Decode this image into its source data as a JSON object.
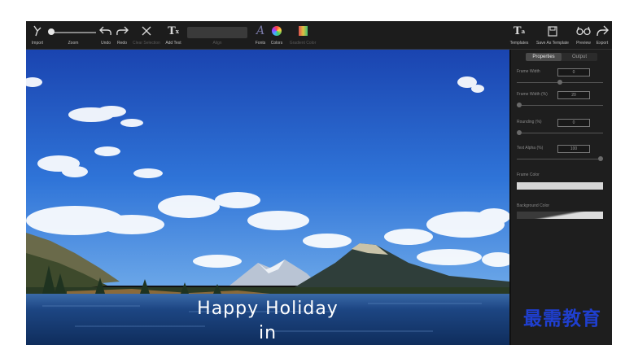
{
  "toolbar": {
    "import": "Import",
    "zoom": "Zoom",
    "undo": "Undo",
    "redo": "Redo",
    "clear_selection": "Clear Selection",
    "add_text": "Add Text",
    "align": "Align",
    "fonts": "Fonts",
    "colors": "Colors",
    "gradient_color": "Gradient Color",
    "templates": "Templates",
    "save_as_template": "Save As Template",
    "preview": "Preview",
    "export": "Export"
  },
  "canvas": {
    "caption_line1": "Happy Holiday",
    "caption_line2": "in"
  },
  "panel": {
    "tabs": [
      "Properties",
      "Output"
    ],
    "frame_width_label": "Frame Width",
    "frame_width_value": "0",
    "frame_width_pct_label": "Frame Width (%)",
    "frame_width_pct_value": "20",
    "rounding_label": "Rounding (%)",
    "rounding_value": "0",
    "text_alpha_label": "Text Alpha (%)",
    "text_alpha_value": "100",
    "frame_color_label": "Frame Color",
    "background_color_label": "Background Color"
  },
  "watermark": "最需教育",
  "colors": {
    "toolbar_bg": "#1c1c1c",
    "panel_bg": "#1e1e1e",
    "sky_top": "#1f4fb8",
    "water": "#1a3f7a",
    "watermark": "#1f3fcf"
  }
}
